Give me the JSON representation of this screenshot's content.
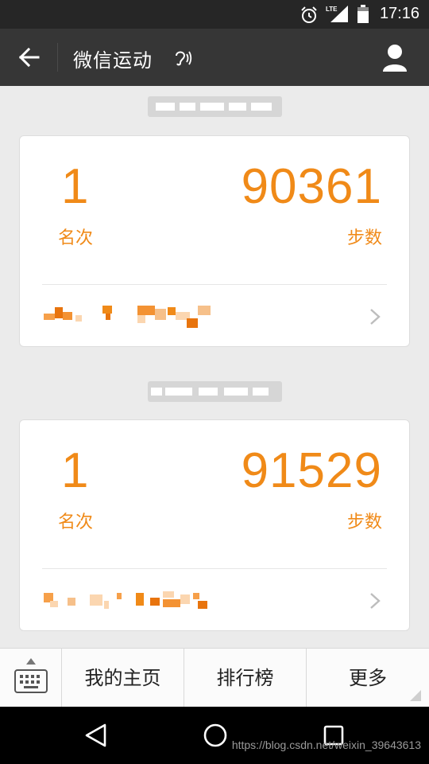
{
  "status_bar": {
    "time": "17:16",
    "network": "LTE",
    "icons": [
      "alarm-icon",
      "lte-signal-icon",
      "battery-icon"
    ]
  },
  "header": {
    "title": "微信运动",
    "icons": [
      "back-arrow-icon",
      "earpiece-icon",
      "profile-icon"
    ]
  },
  "cards": [
    {
      "rank": "1",
      "rank_label": "名次",
      "steps": "90361",
      "steps_label": "步数"
    },
    {
      "rank": "1",
      "rank_label": "名次",
      "steps": "91529",
      "steps_label": "步数"
    }
  ],
  "menu": {
    "items": [
      {
        "label": "我的主页"
      },
      {
        "label": "排行榜"
      },
      {
        "label": "更多"
      }
    ]
  },
  "watermark": "https://blog.csdn.net/weixin_39643613",
  "colors": {
    "accent": "#f08a18",
    "header_bg": "#363636",
    "status_bg": "#262626",
    "page_bg": "#ebebeb"
  }
}
